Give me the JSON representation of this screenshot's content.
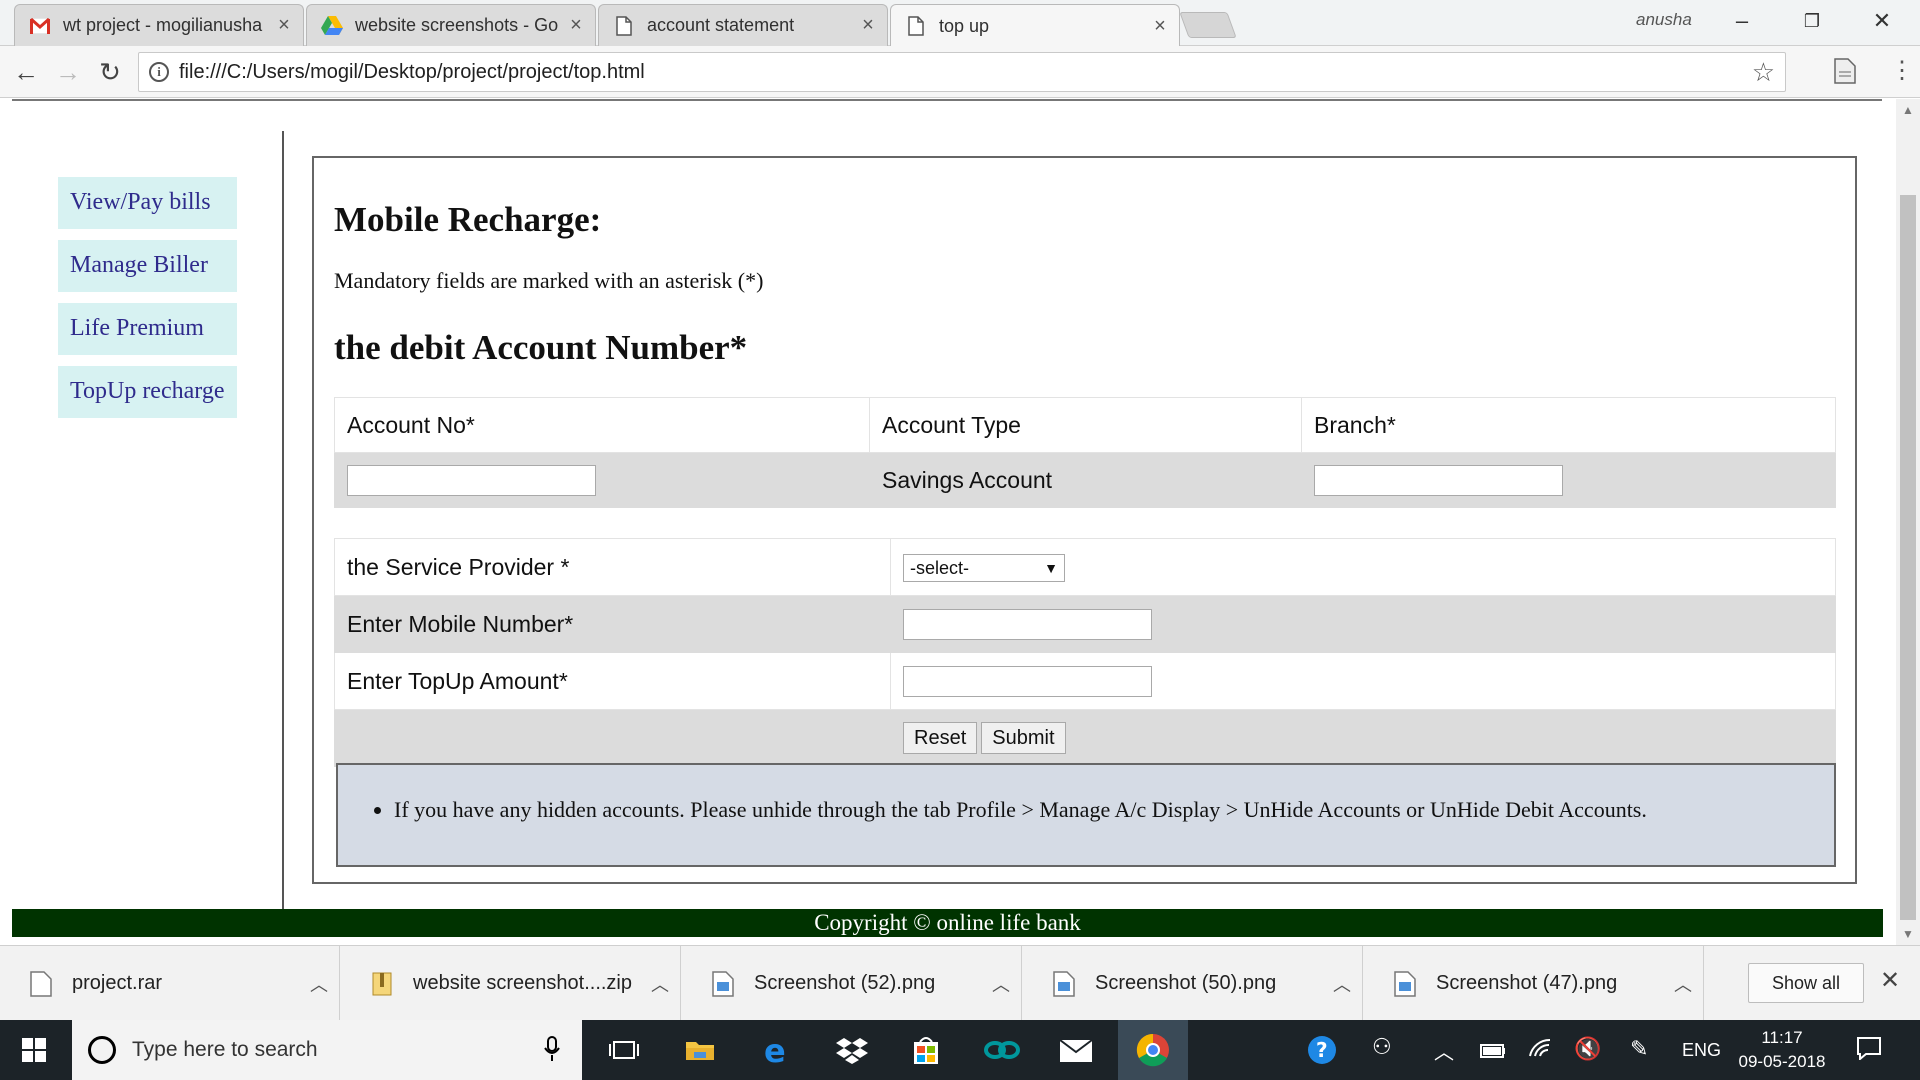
{
  "browser": {
    "tabs": [
      {
        "title": "wt project - mogilianusha",
        "icon": "gmail-icon",
        "active": false
      },
      {
        "title": "website screenshots - Go",
        "icon": "drive-icon",
        "active": false
      },
      {
        "title": "account statement",
        "icon": "page-icon",
        "active": false
      },
      {
        "title": "top up",
        "icon": "page-icon",
        "active": true
      }
    ],
    "profile_name": "anusha",
    "url": "file:///C:/Users/mogil/Desktop/project/project/top.html"
  },
  "sidebar": {
    "items": [
      {
        "label": "View/Pay bills"
      },
      {
        "label": "Manage Biller"
      },
      {
        "label": "Life Premium"
      },
      {
        "label": "TopUp recharge"
      }
    ]
  },
  "main": {
    "title": "Mobile Recharge:",
    "mandatory_note": "Mandatory fields are marked with an asterisk (*)",
    "debit_heading": "the debit Account Number*",
    "account_table": {
      "headers": [
        "Account No*",
        "Account Type",
        "Branch*"
      ],
      "account_no_value": "",
      "account_type_value": "Savings Account",
      "branch_value": ""
    },
    "service_form": {
      "provider_label": "the Service Provider *",
      "provider_selected": "-select-",
      "mobile_label": "Enter Mobile Number*",
      "mobile_value": "",
      "amount_label": "Enter TopUp Amount*",
      "amount_value": "",
      "reset_label": "Reset",
      "submit_label": "Submit"
    },
    "notice": "If you have any hidden accounts. Please unhide through the tab Profile > Manage A/c Display > UnHide Accounts or UnHide Debit Accounts."
  },
  "footer": {
    "text": "Copyright © online life bank"
  },
  "downloads": {
    "items": [
      {
        "name": "project.rar"
      },
      {
        "name": "website screenshot....zip"
      },
      {
        "name": "Screenshot (52).png"
      },
      {
        "name": "Screenshot (50).png"
      },
      {
        "name": "Screenshot (47).png"
      }
    ],
    "show_all_label": "Show all"
  },
  "taskbar": {
    "search_placeholder": "Type here to search",
    "language": "ENG",
    "time": "11:17",
    "date": "09-05-2018"
  },
  "colors": {
    "sidebar_bg": "#d7f2f2",
    "sidebar_text": "#2f2b8c",
    "footer_bg": "#003300",
    "notice_bg": "#d5dbe5",
    "row_grey": "#dcdcdc"
  }
}
